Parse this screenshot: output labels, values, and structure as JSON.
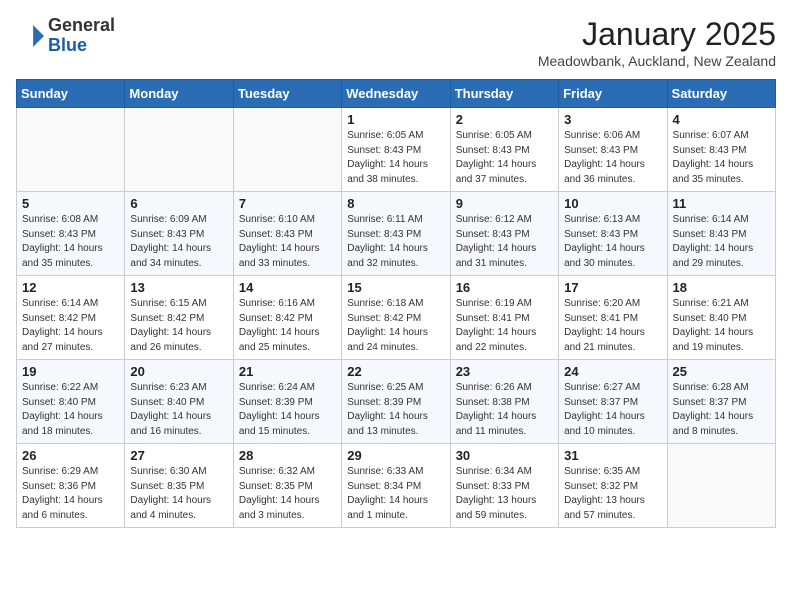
{
  "header": {
    "logo_general": "General",
    "logo_blue": "Blue",
    "month_title": "January 2025",
    "location": "Meadowbank, Auckland, New Zealand"
  },
  "weekdays": [
    "Sunday",
    "Monday",
    "Tuesday",
    "Wednesday",
    "Thursday",
    "Friday",
    "Saturday"
  ],
  "weeks": [
    [
      {
        "day": "",
        "info": ""
      },
      {
        "day": "",
        "info": ""
      },
      {
        "day": "",
        "info": ""
      },
      {
        "day": "1",
        "info": "Sunrise: 6:05 AM\nSunset: 8:43 PM\nDaylight: 14 hours\nand 38 minutes."
      },
      {
        "day": "2",
        "info": "Sunrise: 6:05 AM\nSunset: 8:43 PM\nDaylight: 14 hours\nand 37 minutes."
      },
      {
        "day": "3",
        "info": "Sunrise: 6:06 AM\nSunset: 8:43 PM\nDaylight: 14 hours\nand 36 minutes."
      },
      {
        "day": "4",
        "info": "Sunrise: 6:07 AM\nSunset: 8:43 PM\nDaylight: 14 hours\nand 35 minutes."
      }
    ],
    [
      {
        "day": "5",
        "info": "Sunrise: 6:08 AM\nSunset: 8:43 PM\nDaylight: 14 hours\nand 35 minutes."
      },
      {
        "day": "6",
        "info": "Sunrise: 6:09 AM\nSunset: 8:43 PM\nDaylight: 14 hours\nand 34 minutes."
      },
      {
        "day": "7",
        "info": "Sunrise: 6:10 AM\nSunset: 8:43 PM\nDaylight: 14 hours\nand 33 minutes."
      },
      {
        "day": "8",
        "info": "Sunrise: 6:11 AM\nSunset: 8:43 PM\nDaylight: 14 hours\nand 32 minutes."
      },
      {
        "day": "9",
        "info": "Sunrise: 6:12 AM\nSunset: 8:43 PM\nDaylight: 14 hours\nand 31 minutes."
      },
      {
        "day": "10",
        "info": "Sunrise: 6:13 AM\nSunset: 8:43 PM\nDaylight: 14 hours\nand 30 minutes."
      },
      {
        "day": "11",
        "info": "Sunrise: 6:14 AM\nSunset: 8:43 PM\nDaylight: 14 hours\nand 29 minutes."
      }
    ],
    [
      {
        "day": "12",
        "info": "Sunrise: 6:14 AM\nSunset: 8:42 PM\nDaylight: 14 hours\nand 27 minutes."
      },
      {
        "day": "13",
        "info": "Sunrise: 6:15 AM\nSunset: 8:42 PM\nDaylight: 14 hours\nand 26 minutes."
      },
      {
        "day": "14",
        "info": "Sunrise: 6:16 AM\nSunset: 8:42 PM\nDaylight: 14 hours\nand 25 minutes."
      },
      {
        "day": "15",
        "info": "Sunrise: 6:18 AM\nSunset: 8:42 PM\nDaylight: 14 hours\nand 24 minutes."
      },
      {
        "day": "16",
        "info": "Sunrise: 6:19 AM\nSunset: 8:41 PM\nDaylight: 14 hours\nand 22 minutes."
      },
      {
        "day": "17",
        "info": "Sunrise: 6:20 AM\nSunset: 8:41 PM\nDaylight: 14 hours\nand 21 minutes."
      },
      {
        "day": "18",
        "info": "Sunrise: 6:21 AM\nSunset: 8:40 PM\nDaylight: 14 hours\nand 19 minutes."
      }
    ],
    [
      {
        "day": "19",
        "info": "Sunrise: 6:22 AM\nSunset: 8:40 PM\nDaylight: 14 hours\nand 18 minutes."
      },
      {
        "day": "20",
        "info": "Sunrise: 6:23 AM\nSunset: 8:40 PM\nDaylight: 14 hours\nand 16 minutes."
      },
      {
        "day": "21",
        "info": "Sunrise: 6:24 AM\nSunset: 8:39 PM\nDaylight: 14 hours\nand 15 minutes."
      },
      {
        "day": "22",
        "info": "Sunrise: 6:25 AM\nSunset: 8:39 PM\nDaylight: 14 hours\nand 13 minutes."
      },
      {
        "day": "23",
        "info": "Sunrise: 6:26 AM\nSunset: 8:38 PM\nDaylight: 14 hours\nand 11 minutes."
      },
      {
        "day": "24",
        "info": "Sunrise: 6:27 AM\nSunset: 8:37 PM\nDaylight: 14 hours\nand 10 minutes."
      },
      {
        "day": "25",
        "info": "Sunrise: 6:28 AM\nSunset: 8:37 PM\nDaylight: 14 hours\nand 8 minutes."
      }
    ],
    [
      {
        "day": "26",
        "info": "Sunrise: 6:29 AM\nSunset: 8:36 PM\nDaylight: 14 hours\nand 6 minutes."
      },
      {
        "day": "27",
        "info": "Sunrise: 6:30 AM\nSunset: 8:35 PM\nDaylight: 14 hours\nand 4 minutes."
      },
      {
        "day": "28",
        "info": "Sunrise: 6:32 AM\nSunset: 8:35 PM\nDaylight: 14 hours\nand 3 minutes."
      },
      {
        "day": "29",
        "info": "Sunrise: 6:33 AM\nSunset: 8:34 PM\nDaylight: 14 hours\nand 1 minute."
      },
      {
        "day": "30",
        "info": "Sunrise: 6:34 AM\nSunset: 8:33 PM\nDaylight: 13 hours\nand 59 minutes."
      },
      {
        "day": "31",
        "info": "Sunrise: 6:35 AM\nSunset: 8:32 PM\nDaylight: 13 hours\nand 57 minutes."
      },
      {
        "day": "",
        "info": ""
      }
    ]
  ]
}
